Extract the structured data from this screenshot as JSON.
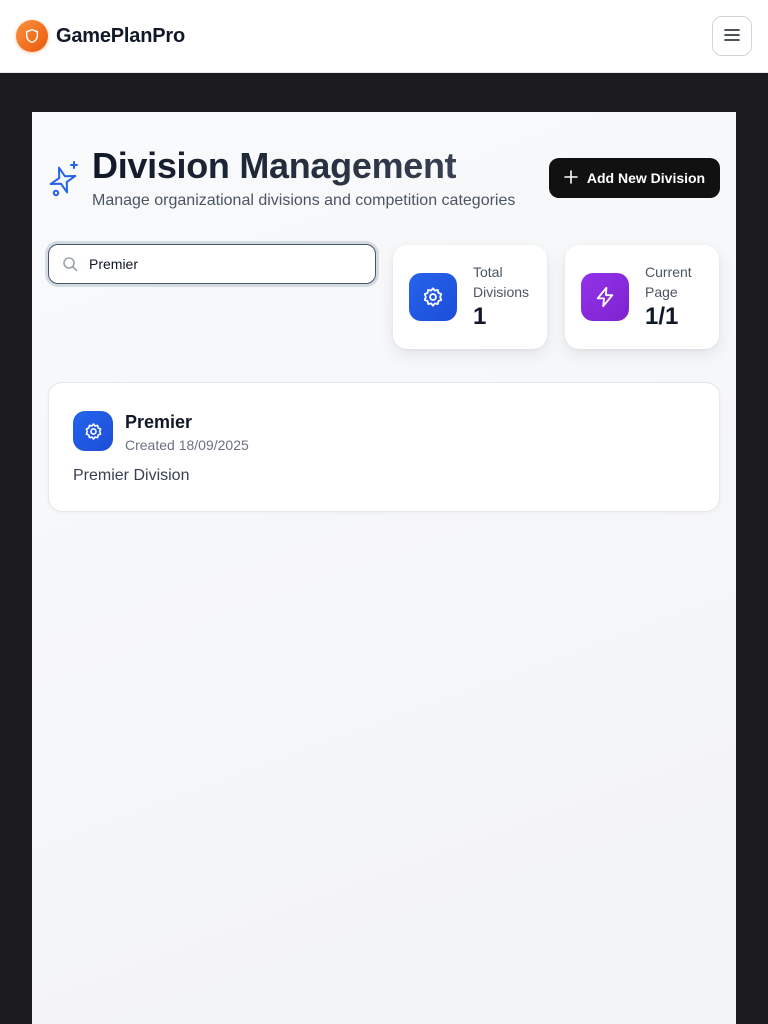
{
  "app": {
    "name": "GamePlanPro",
    "logo_icon": "shield-icon",
    "menu_icon": "hamburger-menu-icon"
  },
  "header": {
    "title": "Division Management",
    "subtitle": "Manage organizational divisions and competition categories",
    "add_button_label": "Add New Division"
  },
  "search": {
    "value": "Premier",
    "placeholder": ""
  },
  "stats": [
    {
      "label": "Total Divisions",
      "value": "1",
      "icon": "gear-icon",
      "color": "#2563eb"
    },
    {
      "label": "Current Page",
      "value": "1/1",
      "icon": "lightning-icon",
      "color": "#9333ea"
    }
  ],
  "divisions": [
    {
      "name": "Premier",
      "created": "Created 18/09/2025",
      "description": "Premier Division",
      "icon": "gear-icon"
    }
  ],
  "colors": {
    "brand_orange": "#f97316",
    "accent_blue": "#2563eb",
    "accent_purple": "#9333ea",
    "dark_button": "#111111"
  }
}
